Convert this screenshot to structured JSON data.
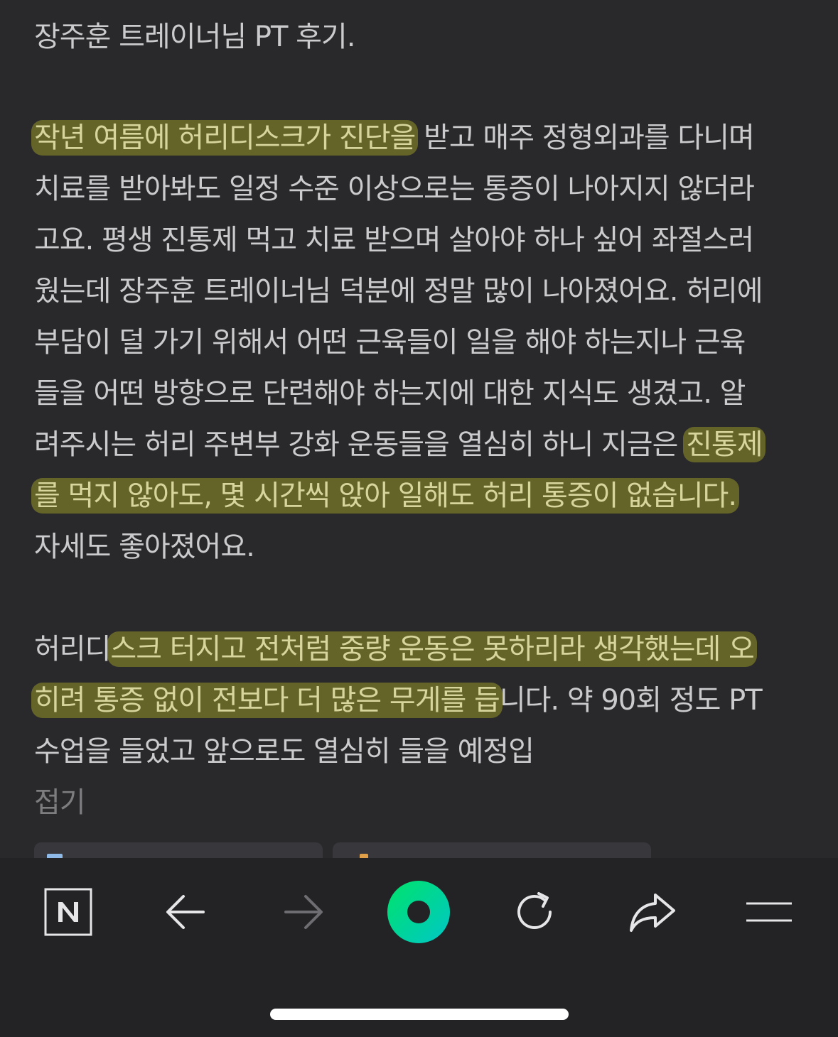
{
  "post": {
    "title_line": "장주훈 트레이너님 PT 후기.",
    "paragraph1": [
      {
        "segments": [
          {
            "text": "작년 여름에 허리디스크가 진단을",
            "highlight": true
          },
          {
            "text": " 받고 매주 정형외과를 다니며",
            "highlight": false
          }
        ]
      },
      {
        "segments": [
          {
            "text": "치료를 받아봐도 일정 수준 이상으로는 통증이 나아지지 않더라",
            "highlight": false
          }
        ]
      },
      {
        "segments": [
          {
            "text": "고요. 평생 진통제 먹고 치료 받으며 살아야 하나 싶어 좌절스러",
            "highlight": false
          }
        ]
      },
      {
        "segments": [
          {
            "text": "웠는데 장주훈 트레이너님 덕분에 정말 많이 나아졌어요. 허리에",
            "highlight": false
          }
        ]
      },
      {
        "segments": [
          {
            "text": "부담이 덜 가기 위해서 어떤 근육들이 일을 해야 하는지나 근육",
            "highlight": false
          }
        ]
      },
      {
        "segments": [
          {
            "text": "들을 어떤 방향으로 단련해야 하는지에 대한 지식도 생겼고. 알",
            "highlight": false
          }
        ]
      },
      {
        "segments": [
          {
            "text": "려주시는 허리 주변부 강화 운동들을 열심히 하니 지금은 ",
            "highlight": false
          },
          {
            "text": "진통제",
            "highlight": true
          }
        ]
      },
      {
        "segments": [
          {
            "text": "를 먹지 않아도, 몇 시간씩 앉아 일해도 허리 통증이 없습니다.",
            "highlight": true
          }
        ]
      },
      {
        "segments": [
          {
            "text": "자세도 좋아졌어요.",
            "highlight": false
          }
        ]
      }
    ],
    "paragraph2": [
      {
        "segments": [
          {
            "text": "허리디",
            "highlight": false
          },
          {
            "text": "스크 터지고 전처럼 중량 운동은 못하리라 생각했는데 오",
            "highlight": true
          }
        ]
      },
      {
        "segments": [
          {
            "text": "히려 통증 없이 전보다 더 많은 무게를 듭",
            "highlight": true
          },
          {
            "text": "니다. 약 90회 정도 PT",
            "highlight": false
          }
        ]
      },
      {
        "segments": [
          {
            "text": "수업을 들었고 앞으로도 열심히 들을 예정입",
            "highlight": false
          }
        ]
      }
    ],
    "fold_label": "접기"
  },
  "toolbar": {
    "buttons": [
      {
        "name": "naver-home-button",
        "icon": "naver-n-icon"
      },
      {
        "name": "back-button",
        "icon": "arrow-left-icon"
      },
      {
        "name": "forward-button",
        "icon": "arrow-right-icon",
        "disabled": true
      },
      {
        "name": "green-dot-button",
        "icon": "green-dot-icon"
      },
      {
        "name": "reload-button",
        "icon": "reload-icon"
      },
      {
        "name": "share-button",
        "icon": "share-icon"
      },
      {
        "name": "menu-button",
        "icon": "menu-icon"
      }
    ]
  },
  "colors": {
    "background": "#29292c",
    "text": "#cbcbcd",
    "highlight": "#96962a",
    "muted": "#7d7d80",
    "toolbar_bg": "#232325",
    "accent_green": "#00d16f"
  }
}
